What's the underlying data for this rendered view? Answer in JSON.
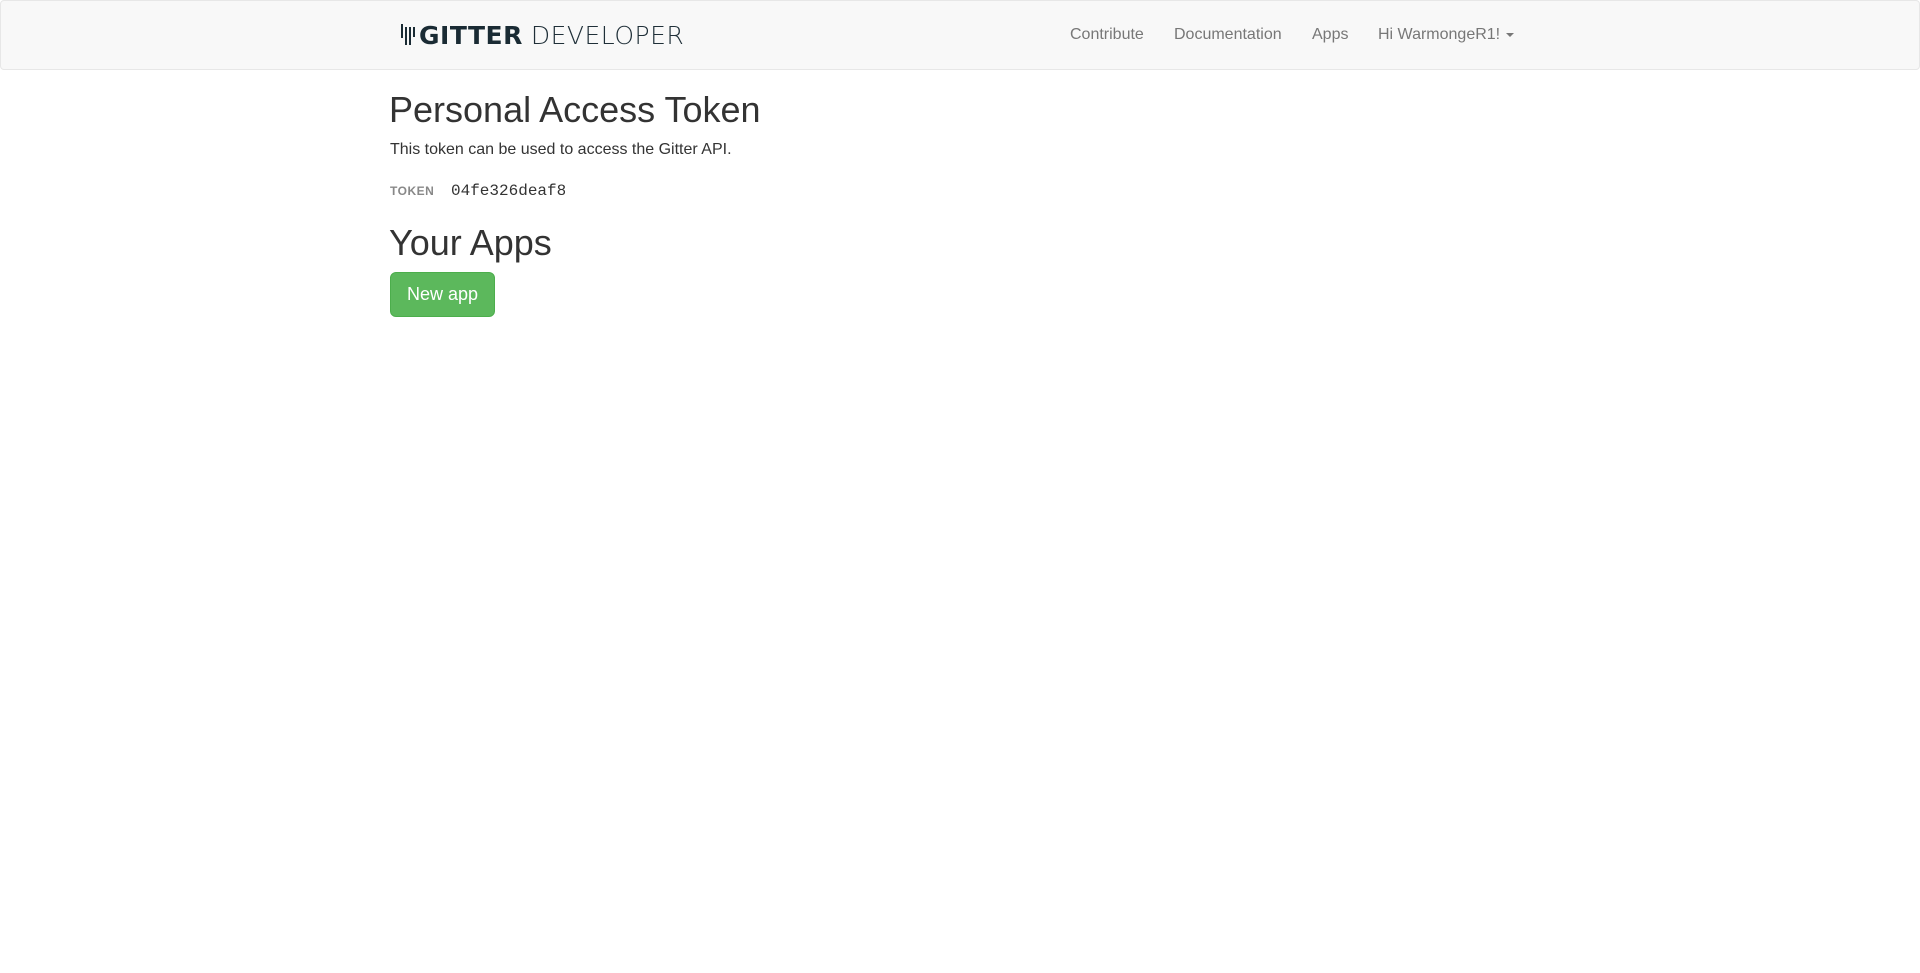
{
  "header": {
    "brand_strong": "GITTER",
    "brand_light": "DEVELOPER",
    "brand_icon": "gitter-logo-icon",
    "nav": {
      "contribute": "Contribute",
      "documentation": "Documentation",
      "apps": "Apps",
      "user_menu": "Hi WarmongeR1!"
    }
  },
  "token_section": {
    "title": "Personal Access Token",
    "description": "This token can be used to access the Gitter API.",
    "label": "TOKEN",
    "value": "04fe326deaf8"
  },
  "apps_section": {
    "title": "Your Apps",
    "new_app_label": "New app"
  },
  "colors": {
    "navbar_bg": "#f8f8f8",
    "brand": "#1a2b34",
    "nav_text": "#777777",
    "button_success": "#5cb85c"
  }
}
